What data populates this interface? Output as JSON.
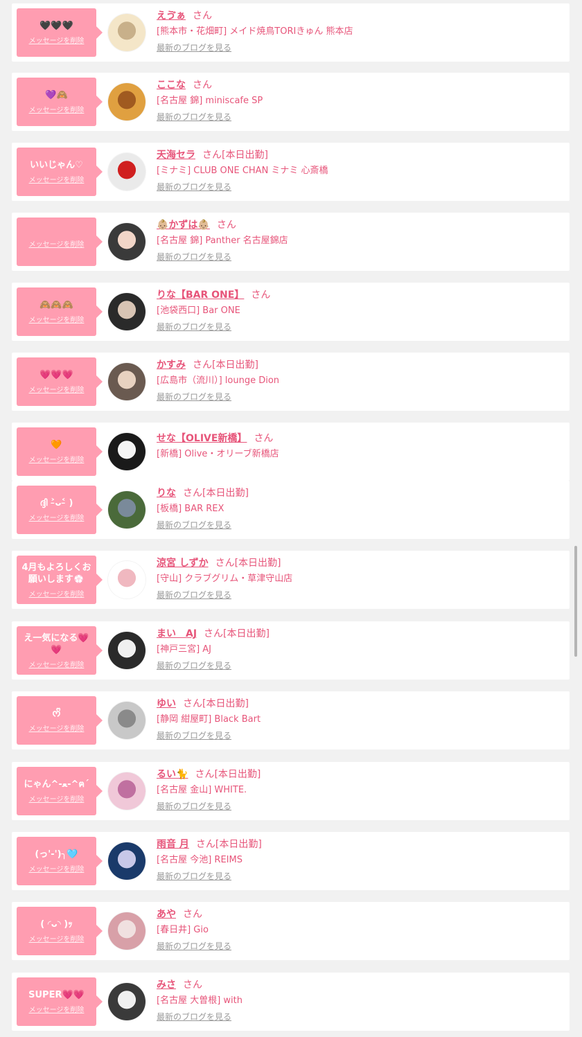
{
  "delete_label": "メッセージを削除",
  "blog_label": "最新のブログを見る",
  "san": "さん",
  "entries": [
    {
      "msg": "🖤🖤🖤",
      "name": "えゔぁ",
      "status": "",
      "shop": "[熊本市・花畑町] メイド焼鳥TORIきゅん 熊本店",
      "blog": true,
      "avatar": [
        "#f4e6c8",
        "#c8b08a"
      ]
    },
    {
      "msg": "💜🙈",
      "name": "ここな",
      "status": "",
      "shop": "[名古屋 錦] miniscafe SP",
      "blog": true,
      "avatar": [
        "#e0a040",
        "#a05a20"
      ]
    },
    {
      "msg": "いいじゃん♡",
      "name": "天海セラ",
      "status": "[本日出勤]",
      "shop": "[ミナミ] CLUB ONE CHAN ミナミ 心斎橋",
      "blog": true,
      "avatar": [
        "#eaeaea",
        "#d02020"
      ]
    },
    {
      "msg": "",
      "name": "👶🏼かずは👶🏼",
      "status": "",
      "shop": "[名古屋 錦] Panther 名古屋錦店",
      "blog": true,
      "avatar": [
        "#3a3a3a",
        "#f2d6c8"
      ]
    },
    {
      "msg": "🙈🙈🙈",
      "name": "りな【BAR ONE】",
      "status": "",
      "shop": "[池袋西口] Bar ONE",
      "blog": true,
      "avatar": [
        "#2a2a2a",
        "#d8c4b4"
      ]
    },
    {
      "msg": "💗💗💗",
      "name": "かすみ",
      "status": "[本日出勤]",
      "shop": "[広島市（流川）] lounge Dion",
      "blog": true,
      "avatar": [
        "#6a5a50",
        "#e8d2c0"
      ]
    },
    {
      "msg": "🧡",
      "name": "せな【OLIVE新橋】",
      "status": "",
      "shop": "[新橋] Olive・オリーブ新橋店",
      "blog": false,
      "avatar": [
        "#1a1a1a",
        "#f5f5f5"
      ]
    },
    {
      "msg": "ദ്ദി ˃̵ᴗ˂̵ )",
      "name": "りな",
      "status": "[本日出勤]",
      "shop": "[板橋] BAR REX",
      "blog": true,
      "avatar": [
        "#4a6a3a",
        "#7a8a9a"
      ]
    },
    {
      "msg": "4月もよろしくお願いします💮",
      "name": "涼宮 しずか",
      "status": "[本日出勤]",
      "shop": "[守山] クラブグリム・草津守山店",
      "blog": true,
      "avatar": [
        "#ffffff",
        "#f0b8c0"
      ]
    },
    {
      "msg": "え一気になる💗💗",
      "name": "まい　AJ",
      "status": "[本日出勤]",
      "shop": "[神戸三宮] AJ",
      "blog": true,
      "avatar": [
        "#2a2a2a",
        "#f0f0f0"
      ]
    },
    {
      "msg": "ᰔᩚ",
      "name": "ゆい",
      "status": "[本日出勤]",
      "shop": "[静岡 紺屋町] Black Bart",
      "blog": true,
      "avatar": [
        "#c8c8c8",
        "#8a8a8a"
      ]
    },
    {
      "msg": "にゃん^-ﻌ-^ฅ´",
      "name": "るい🐈",
      "status": "[本日出勤]",
      "shop": "[名古屋 金山] WHITE.",
      "blog": true,
      "avatar": [
        "#f0c8d8",
        "#c070a0"
      ]
    },
    {
      "msg": "(っ'-')╮🩵",
      "name": "雨音 月",
      "status": "[本日出勤]",
      "shop": "[名古屋 今池] REIMS",
      "blog": true,
      "avatar": [
        "#1a3a6a",
        "#c8c8e8"
      ]
    },
    {
      "msg": "( ◜ᴗ◝ )ｯ",
      "name": "あや",
      "status": "",
      "shop": "[春日井] Gio",
      "blog": true,
      "avatar": [
        "#d8a0a8",
        "#f0e0e0"
      ]
    },
    {
      "msg": "SUPER💗💗",
      "name": "みさ",
      "status": "",
      "shop": "[名古屋 大曽根] with",
      "blog": true,
      "avatar": [
        "#3a3a3a",
        "#f0f0f0"
      ]
    }
  ],
  "colors": {
    "accent": "#e7557a",
    "bubble": "#ff9db1",
    "background": "#f1f1f1"
  }
}
